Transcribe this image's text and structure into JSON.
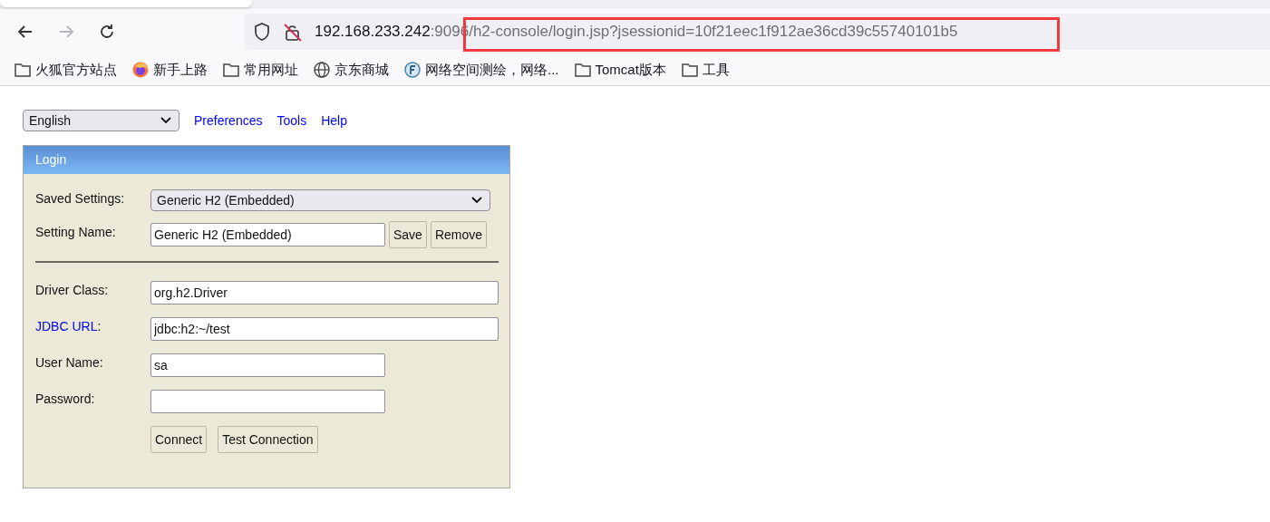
{
  "browser": {
    "nav_buttons": [
      {
        "kind": "back",
        "disabled": false
      },
      {
        "kind": "forward",
        "disabled": true
      },
      {
        "kind": "reload",
        "disabled": false
      }
    ],
    "url": {
      "host": "192.168.233.242",
      "rest": ":9096/h2-console/login.jsp?jsessionid=10f21eec1f912ae36cd39c55740101b5"
    },
    "annotation": {
      "kind": "red-box"
    },
    "bookmarks": [
      {
        "kind": "folder",
        "label": "火狐官方站点"
      },
      {
        "kind": "firefox",
        "label": "新手上路"
      },
      {
        "kind": "folder",
        "label": "常用网址"
      },
      {
        "kind": "globe",
        "label": "京东商城"
      },
      {
        "kind": "app",
        "label": "网络空间测绘，网络..."
      },
      {
        "kind": "folder",
        "label": "Tomcat版本"
      },
      {
        "kind": "folder",
        "label": "工具"
      }
    ]
  },
  "page": {
    "language": "English",
    "links": [
      "Preferences",
      "Tools",
      "Help"
    ],
    "login": {
      "title": "Login",
      "rows": [
        {
          "kind": "select",
          "label": "Saved Settings:",
          "value": "Generic H2 (Embedded)"
        },
        {
          "kind": "name",
          "label": "Setting Name:",
          "value": "Generic H2 (Embedded)",
          "buttons": [
            "Save",
            "Remove"
          ]
        },
        {
          "kind": "divider"
        },
        {
          "kind": "wide",
          "label": "Driver Class:",
          "value": "org.h2.Driver"
        },
        {
          "kind": "wide",
          "label": "JDBC URL",
          "label_link": true,
          "label_suffix": ":",
          "value": "jdbc:h2:~/test"
        },
        {
          "kind": "short",
          "label": "User Name:",
          "value": "sa"
        },
        {
          "kind": "password",
          "label": "Password:"
        },
        {
          "kind": "actions",
          "buttons": [
            "Connect",
            "Test Connection"
          ]
        }
      ]
    }
  }
}
